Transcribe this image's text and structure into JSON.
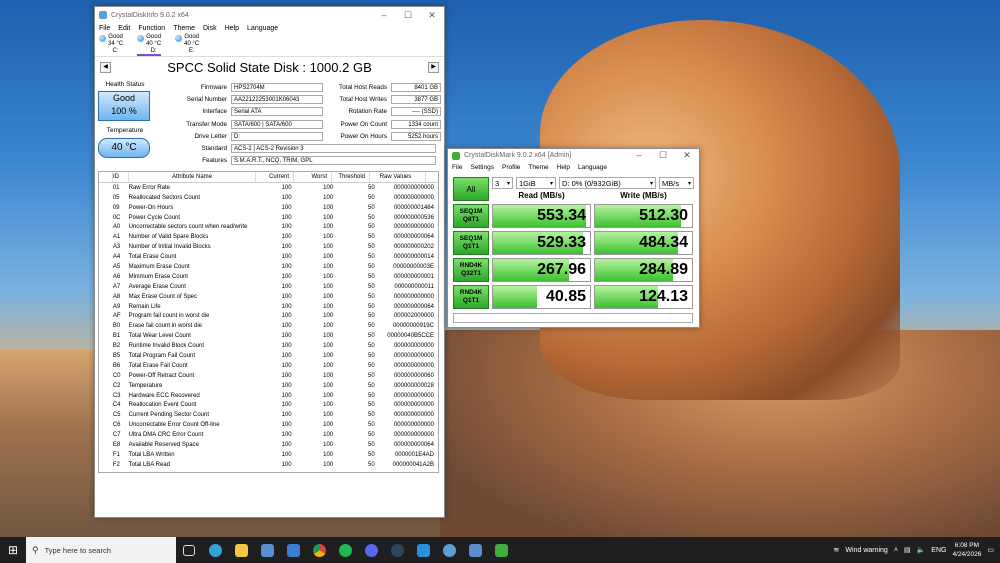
{
  "cdi": {
    "title": "CrystalDiskInfo 9.0.2 x64",
    "menu": [
      "File",
      "Edit",
      "Function",
      "Theme",
      "Disk",
      "Help",
      "Language"
    ],
    "drives": [
      {
        "status": "Good",
        "temp": "34 °C",
        "letter": "C:"
      },
      {
        "status": "Good",
        "temp": "40 °C",
        "letter": "D:"
      },
      {
        "status": "Good",
        "temp": "40 °C",
        "letter": "E:"
      }
    ],
    "disk_title": "SPCC Solid State Disk : 1000.2 GB",
    "health_label": "Health Status",
    "health_status": "Good",
    "health_percent": "100 %",
    "temperature_label": "Temperature",
    "temperature": "40 °C",
    "left_info": [
      {
        "label": "Firmware",
        "value": "HPS2704M"
      },
      {
        "label": "Serial Number",
        "value": "AA22122253001K06043"
      },
      {
        "label": "Interface",
        "value": "Serial ATA"
      },
      {
        "label": "Transfer Mode",
        "value": "SATA/600 | SATA/600"
      },
      {
        "label": "Drive Letter",
        "value": "D:"
      },
      {
        "label": "Standard",
        "value": "ACS-2 | ACS-2 Revision 3"
      },
      {
        "label": "Features",
        "value": "S.M.A.R.T., NCQ, TRIM, GPL"
      }
    ],
    "right_info": [
      {
        "label": "Total Host Reads",
        "value": "8401 GB"
      },
      {
        "label": "Total Host Writes",
        "value": "3877 GB"
      },
      {
        "label": "Rotation Rate",
        "value": "---- (SSD)"
      },
      {
        "label": "Power On Count",
        "value": "1334 count"
      },
      {
        "label": "Power On Hours",
        "value": "5252 hours"
      }
    ],
    "smart_headers": [
      "ID",
      "Attribute Name",
      "Current",
      "Worst",
      "Threshold",
      "Raw Values"
    ],
    "smart_rows": [
      [
        "01",
        "Raw Error Rate",
        "100",
        "100",
        "50",
        "000000000000"
      ],
      [
        "05",
        "Reallocated Sectors Count",
        "100",
        "100",
        "50",
        "000000000000"
      ],
      [
        "09",
        "Power-On Hours",
        "100",
        "100",
        "50",
        "000000001484"
      ],
      [
        "0C",
        "Power Cycle Count",
        "100",
        "100",
        "50",
        "000000000536"
      ],
      [
        "A0",
        "Uncorrectable sectors count when read/write",
        "100",
        "100",
        "50",
        "000000000000"
      ],
      [
        "A1",
        "Number of Valid Spare Blocks",
        "100",
        "100",
        "50",
        "000000000064"
      ],
      [
        "A3",
        "Number of Initial Invalid Blocks",
        "100",
        "100",
        "50",
        "000000000202"
      ],
      [
        "A4",
        "Total Erase Count",
        "100",
        "100",
        "50",
        "000000000014"
      ],
      [
        "A5",
        "Maximum Erase Count",
        "100",
        "100",
        "50",
        "00000000003E"
      ],
      [
        "A6",
        "Minimum Erase Count",
        "100",
        "100",
        "50",
        "000000000001"
      ],
      [
        "A7",
        "Average Erase Count",
        "100",
        "100",
        "50",
        "000000000011"
      ],
      [
        "A8",
        "Max Erase Count of Spec",
        "100",
        "100",
        "50",
        "000000000000"
      ],
      [
        "A9",
        "Remain Life",
        "100",
        "100",
        "50",
        "000000000064"
      ],
      [
        "AF",
        "Program fail count in worst die",
        "100",
        "100",
        "50",
        "000002000000"
      ],
      [
        "B0",
        "Erase fail count in worst die",
        "100",
        "100",
        "50",
        "00000000919C"
      ],
      [
        "B1",
        "Total Wear Level Count",
        "100",
        "100",
        "50",
        "00000040B5CCE"
      ],
      [
        "B2",
        "Runtime Invalid Block Count",
        "100",
        "100",
        "50",
        "000000000000"
      ],
      [
        "B5",
        "Total Program Fail Count",
        "100",
        "100",
        "50",
        "000000000000"
      ],
      [
        "B6",
        "Total Erase Fail Count",
        "100",
        "100",
        "50",
        "000000000000"
      ],
      [
        "C0",
        "Power-Off Retract Count",
        "100",
        "100",
        "50",
        "000000000060"
      ],
      [
        "C2",
        "Temperature",
        "100",
        "100",
        "50",
        "000000000028"
      ],
      [
        "C3",
        "Hardware ECC Recovered",
        "100",
        "100",
        "50",
        "000000000000"
      ],
      [
        "C4",
        "Reallocation Event Count",
        "100",
        "100",
        "50",
        "000000000000"
      ],
      [
        "C5",
        "Current Pending Sector Count",
        "100",
        "100",
        "50",
        "000000000000"
      ],
      [
        "C6",
        "Uncorrectable Error Count Off-line",
        "100",
        "100",
        "50",
        "000000000000"
      ],
      [
        "C7",
        "Ultra DMA CRC Error Count",
        "100",
        "100",
        "50",
        "000000000000"
      ],
      [
        "E8",
        "Available Reserved Space",
        "100",
        "100",
        "50",
        "000000000064"
      ],
      [
        "F1",
        "Total LBA Written",
        "100",
        "100",
        "50",
        "0000001E4AD"
      ],
      [
        "F2",
        "Total LBA Read",
        "100",
        "100",
        "50",
        "000000041A2B"
      ]
    ]
  },
  "cdm": {
    "title": "CrystalDiskMark 9.0.2 x64 [Admin]",
    "menu": [
      "File",
      "Settings",
      "Profile",
      "Theme",
      "Help",
      "Language"
    ],
    "all_label": "All",
    "count": "3",
    "size": "1GiB",
    "drive": "D: 0% (0/932GiB)",
    "unit": "MB/s",
    "read_header": "Read (MB/s)",
    "write_header": "Write (MB/s)",
    "tests": [
      {
        "line1": "SEQ1M",
        "line2": "Q8T1",
        "read": "553.34",
        "write": "512.30",
        "read_fill": 0.96,
        "write_fill": 0.89
      },
      {
        "line1": "SEQ1M",
        "line2": "Q1T1",
        "read": "529.33",
        "write": "484.34",
        "read_fill": 0.93,
        "write_fill": 0.86
      },
      {
        "line1": "RND4K",
        "line2": "Q32T1",
        "read": "267.96",
        "write": "284.89",
        "read_fill": 0.78,
        "write_fill": 0.8
      },
      {
        "line1": "RND4K",
        "line2": "Q1T1",
        "read": "40.85",
        "write": "124.13",
        "read_fill": 0.45,
        "write_fill": 0.65
      }
    ]
  },
  "taskbar": {
    "search_placeholder": "Type here to search",
    "weather": "Wind warning",
    "lang": "ENG",
    "time": "6:08 PM",
    "date": "4/24/2026"
  }
}
